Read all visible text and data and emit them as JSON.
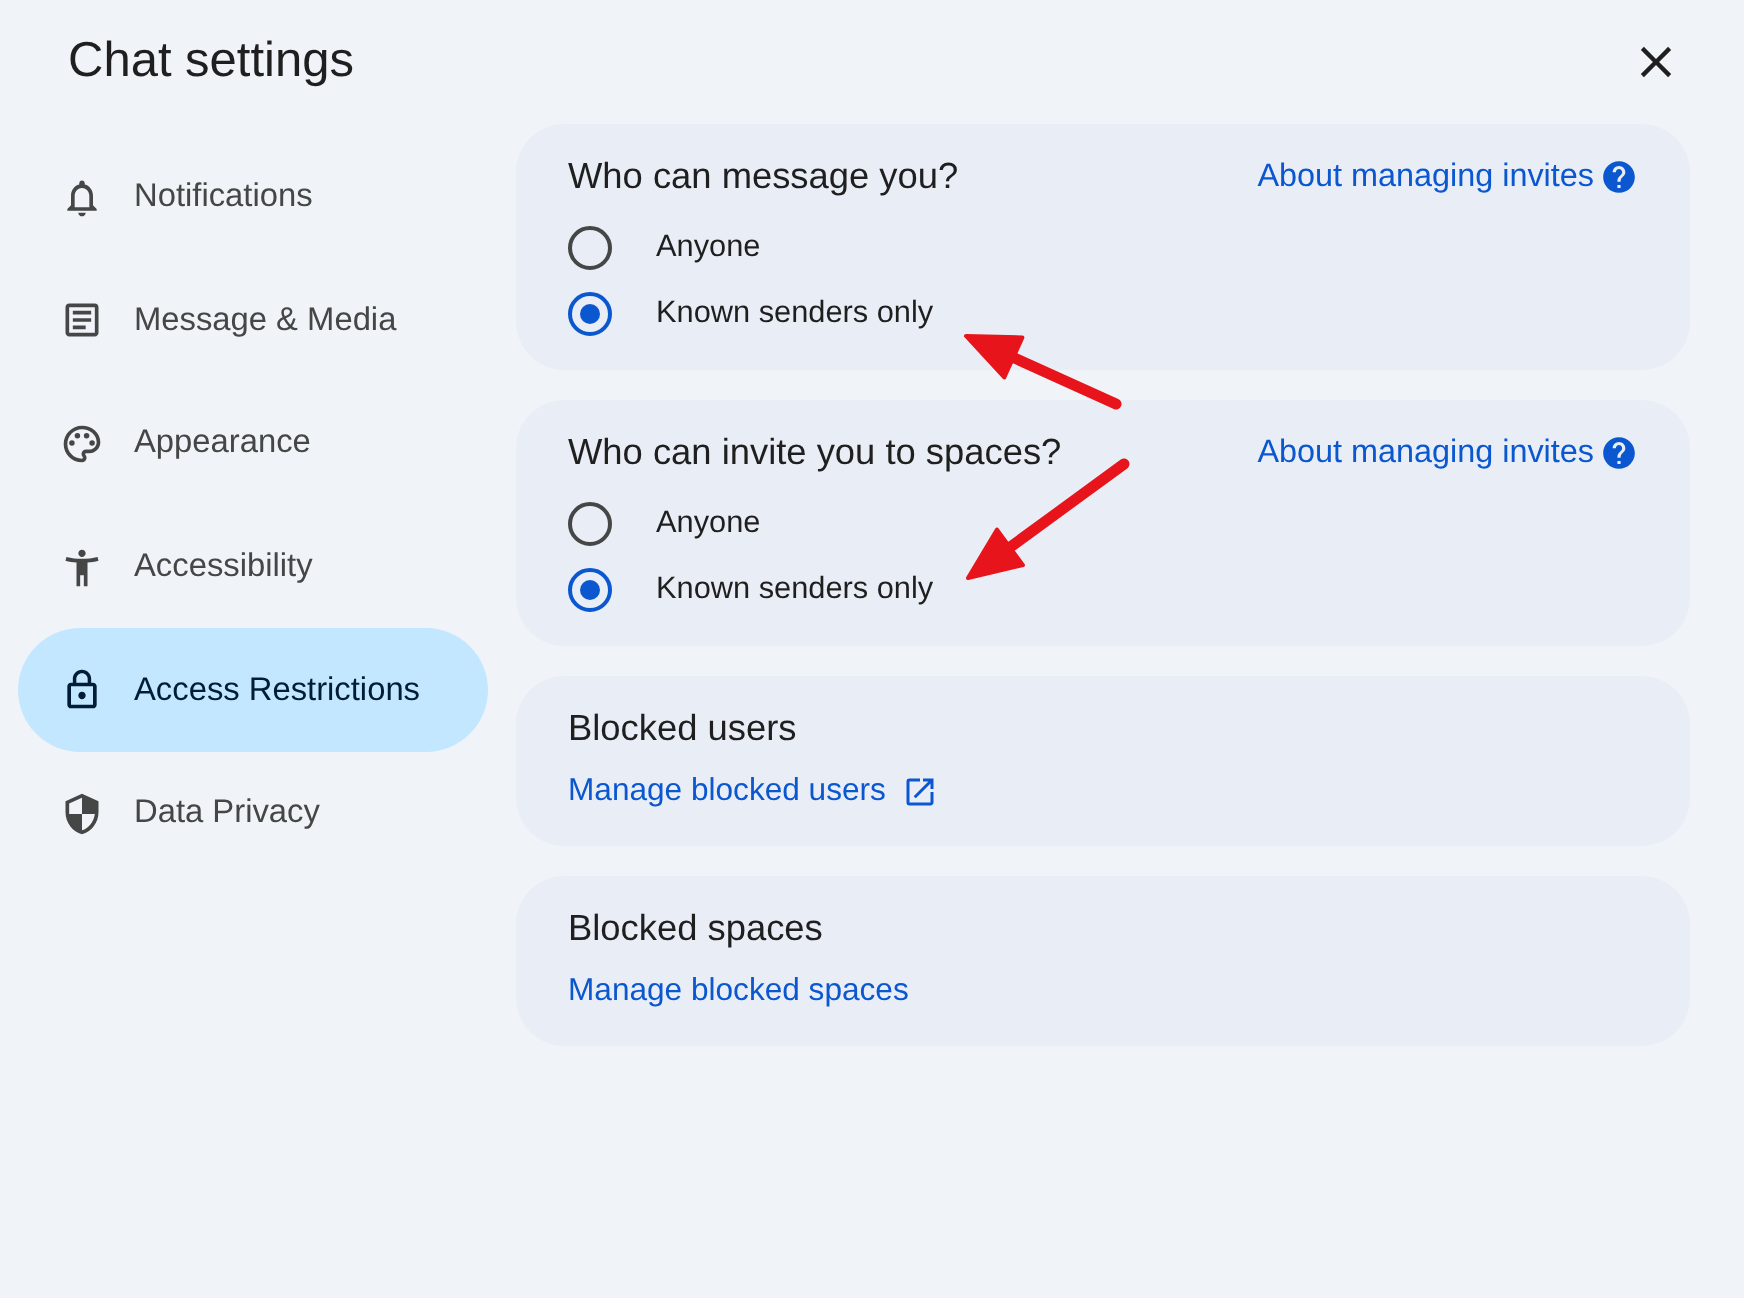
{
  "window": {
    "title": "Chat settings"
  },
  "sidebar": {
    "items": [
      {
        "label": "Notifications",
        "selected": false
      },
      {
        "label": "Message & Media",
        "selected": false
      },
      {
        "label": "Appearance",
        "selected": false
      },
      {
        "label": "Accessibility",
        "selected": false
      },
      {
        "label": "Access Restrictions",
        "selected": true
      },
      {
        "label": "Data Privacy",
        "selected": false
      }
    ]
  },
  "sections": [
    {
      "kind": "radio",
      "heading": "Who can message you?",
      "help_link": "About managing invites",
      "options": [
        {
          "label": "Anyone",
          "selected": false
        },
        {
          "label": "Known senders only",
          "selected": true
        }
      ]
    },
    {
      "kind": "radio",
      "heading": "Who can invite you to spaces?",
      "help_link": "About managing invites",
      "options": [
        {
          "label": "Anyone",
          "selected": false
        },
        {
          "label": "Known senders only",
          "selected": true
        }
      ]
    },
    {
      "kind": "link",
      "heading": "Blocked users",
      "link": {
        "label": "Manage blocked users",
        "external": true
      }
    },
    {
      "kind": "link",
      "heading": "Blocked spaces",
      "link": {
        "label": "Manage blocked spaces",
        "external": false
      }
    }
  ]
}
